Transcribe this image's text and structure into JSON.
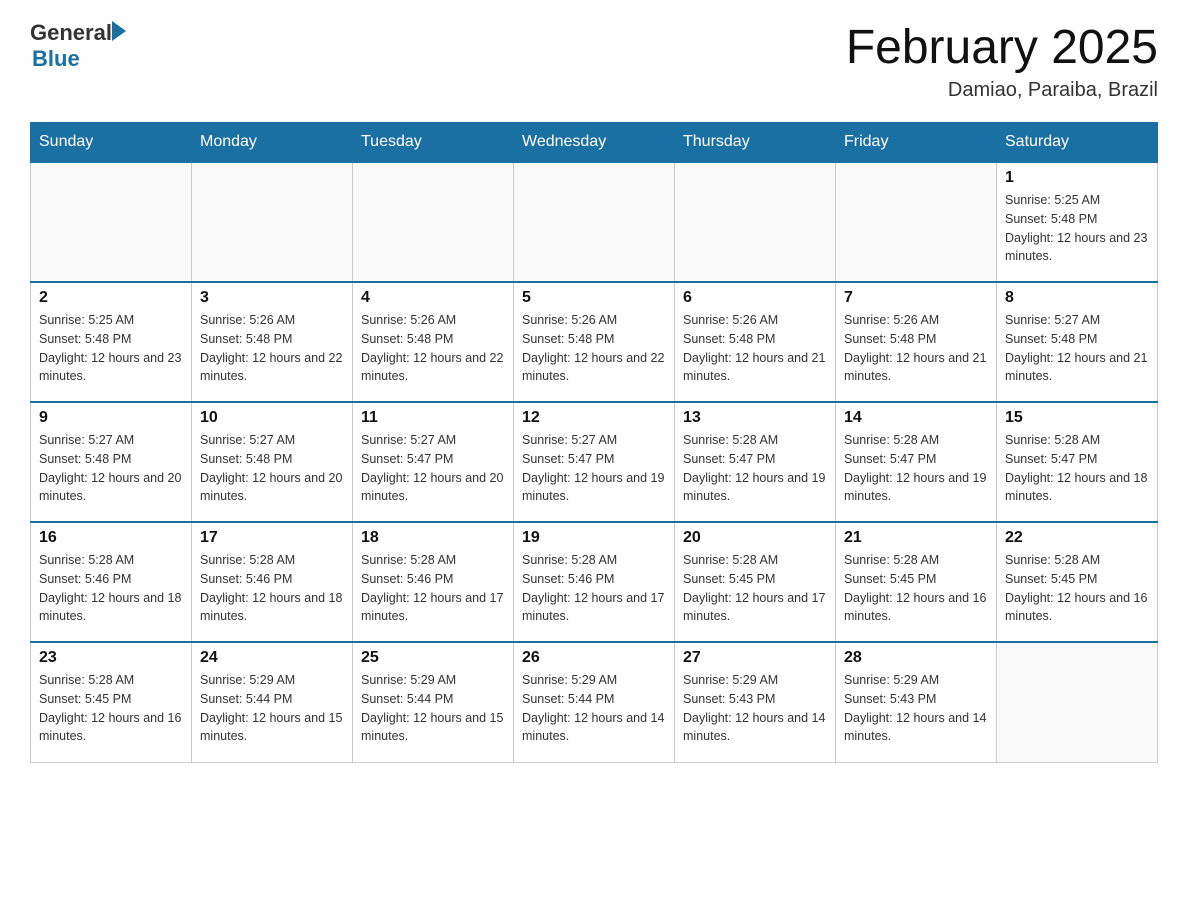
{
  "header": {
    "logo_general": "General",
    "logo_blue": "Blue",
    "month_title": "February 2025",
    "location": "Damiao, Paraiba, Brazil"
  },
  "days_of_week": [
    "Sunday",
    "Monday",
    "Tuesday",
    "Wednesday",
    "Thursday",
    "Friday",
    "Saturday"
  ],
  "weeks": [
    [
      {
        "day": "",
        "info": ""
      },
      {
        "day": "",
        "info": ""
      },
      {
        "day": "",
        "info": ""
      },
      {
        "day": "",
        "info": ""
      },
      {
        "day": "",
        "info": ""
      },
      {
        "day": "",
        "info": ""
      },
      {
        "day": "1",
        "info": "Sunrise: 5:25 AM\nSunset: 5:48 PM\nDaylight: 12 hours and 23 minutes."
      }
    ],
    [
      {
        "day": "2",
        "info": "Sunrise: 5:25 AM\nSunset: 5:48 PM\nDaylight: 12 hours and 23 minutes."
      },
      {
        "day": "3",
        "info": "Sunrise: 5:26 AM\nSunset: 5:48 PM\nDaylight: 12 hours and 22 minutes."
      },
      {
        "day": "4",
        "info": "Sunrise: 5:26 AM\nSunset: 5:48 PM\nDaylight: 12 hours and 22 minutes."
      },
      {
        "day": "5",
        "info": "Sunrise: 5:26 AM\nSunset: 5:48 PM\nDaylight: 12 hours and 22 minutes."
      },
      {
        "day": "6",
        "info": "Sunrise: 5:26 AM\nSunset: 5:48 PM\nDaylight: 12 hours and 21 minutes."
      },
      {
        "day": "7",
        "info": "Sunrise: 5:26 AM\nSunset: 5:48 PM\nDaylight: 12 hours and 21 minutes."
      },
      {
        "day": "8",
        "info": "Sunrise: 5:27 AM\nSunset: 5:48 PM\nDaylight: 12 hours and 21 minutes."
      }
    ],
    [
      {
        "day": "9",
        "info": "Sunrise: 5:27 AM\nSunset: 5:48 PM\nDaylight: 12 hours and 20 minutes."
      },
      {
        "day": "10",
        "info": "Sunrise: 5:27 AM\nSunset: 5:48 PM\nDaylight: 12 hours and 20 minutes."
      },
      {
        "day": "11",
        "info": "Sunrise: 5:27 AM\nSunset: 5:47 PM\nDaylight: 12 hours and 20 minutes."
      },
      {
        "day": "12",
        "info": "Sunrise: 5:27 AM\nSunset: 5:47 PM\nDaylight: 12 hours and 19 minutes."
      },
      {
        "day": "13",
        "info": "Sunrise: 5:28 AM\nSunset: 5:47 PM\nDaylight: 12 hours and 19 minutes."
      },
      {
        "day": "14",
        "info": "Sunrise: 5:28 AM\nSunset: 5:47 PM\nDaylight: 12 hours and 19 minutes."
      },
      {
        "day": "15",
        "info": "Sunrise: 5:28 AM\nSunset: 5:47 PM\nDaylight: 12 hours and 18 minutes."
      }
    ],
    [
      {
        "day": "16",
        "info": "Sunrise: 5:28 AM\nSunset: 5:46 PM\nDaylight: 12 hours and 18 minutes."
      },
      {
        "day": "17",
        "info": "Sunrise: 5:28 AM\nSunset: 5:46 PM\nDaylight: 12 hours and 18 minutes."
      },
      {
        "day": "18",
        "info": "Sunrise: 5:28 AM\nSunset: 5:46 PM\nDaylight: 12 hours and 17 minutes."
      },
      {
        "day": "19",
        "info": "Sunrise: 5:28 AM\nSunset: 5:46 PM\nDaylight: 12 hours and 17 minutes."
      },
      {
        "day": "20",
        "info": "Sunrise: 5:28 AM\nSunset: 5:45 PM\nDaylight: 12 hours and 17 minutes."
      },
      {
        "day": "21",
        "info": "Sunrise: 5:28 AM\nSunset: 5:45 PM\nDaylight: 12 hours and 16 minutes."
      },
      {
        "day": "22",
        "info": "Sunrise: 5:28 AM\nSunset: 5:45 PM\nDaylight: 12 hours and 16 minutes."
      }
    ],
    [
      {
        "day": "23",
        "info": "Sunrise: 5:28 AM\nSunset: 5:45 PM\nDaylight: 12 hours and 16 minutes."
      },
      {
        "day": "24",
        "info": "Sunrise: 5:29 AM\nSunset: 5:44 PM\nDaylight: 12 hours and 15 minutes."
      },
      {
        "day": "25",
        "info": "Sunrise: 5:29 AM\nSunset: 5:44 PM\nDaylight: 12 hours and 15 minutes."
      },
      {
        "day": "26",
        "info": "Sunrise: 5:29 AM\nSunset: 5:44 PM\nDaylight: 12 hours and 14 minutes."
      },
      {
        "day": "27",
        "info": "Sunrise: 5:29 AM\nSunset: 5:43 PM\nDaylight: 12 hours and 14 minutes."
      },
      {
        "day": "28",
        "info": "Sunrise: 5:29 AM\nSunset: 5:43 PM\nDaylight: 12 hours and 14 minutes."
      },
      {
        "day": "",
        "info": ""
      }
    ]
  ]
}
